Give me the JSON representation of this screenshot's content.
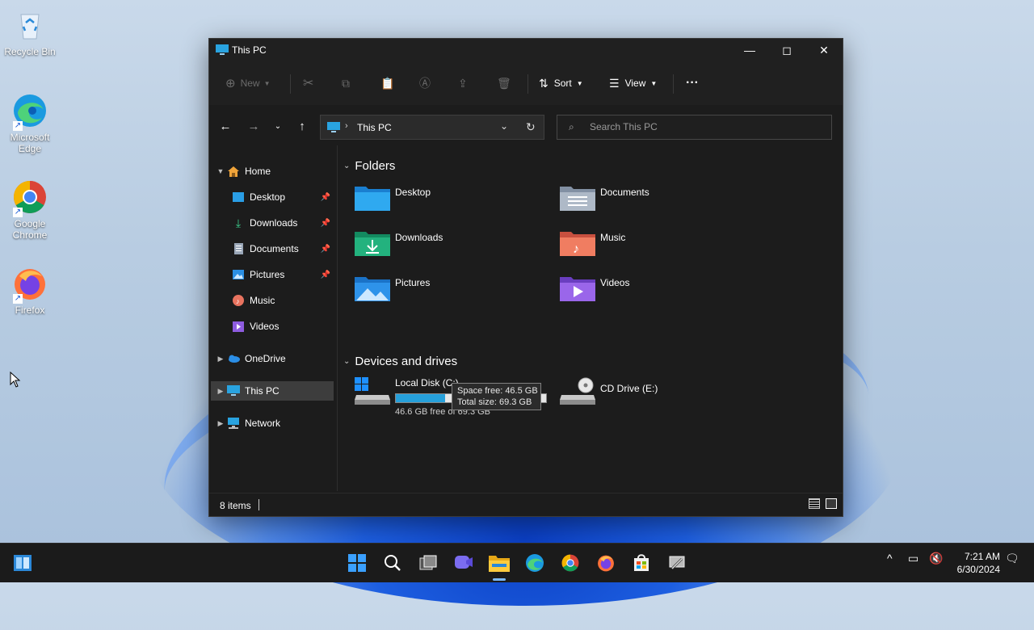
{
  "desktop": {
    "icons": [
      {
        "label": "Recycle Bin"
      },
      {
        "label": "Microsoft Edge"
      },
      {
        "label": "Google Chrome"
      },
      {
        "label": "Firefox"
      }
    ]
  },
  "window": {
    "title": "This PC",
    "toolbar": {
      "new_label": "New",
      "sort_label": "Sort",
      "view_label": "View",
      "more_label": "···"
    },
    "address": {
      "path": "This PC"
    },
    "search": {
      "placeholder": "Search This PC"
    },
    "sidebar": {
      "home": "Home",
      "items": [
        {
          "label": "Desktop"
        },
        {
          "label": "Downloads"
        },
        {
          "label": "Documents"
        },
        {
          "label": "Pictures"
        },
        {
          "label": "Music"
        },
        {
          "label": "Videos"
        }
      ],
      "onedrive": "OneDrive",
      "this_pc": "This PC",
      "network": "Network"
    },
    "folders": {
      "header": "Folders",
      "items": [
        {
          "name": "Desktop"
        },
        {
          "name": "Documents"
        },
        {
          "name": "Downloads"
        },
        {
          "name": "Music"
        },
        {
          "name": "Pictures"
        },
        {
          "name": "Videos"
        }
      ]
    },
    "drives": {
      "header": "Devices and drives",
      "local_disk": {
        "name": "Local Disk (C:)",
        "free_text": "46.6 GB free of 69.3 GB",
        "used_fraction": 0.33
      },
      "cd_drive": {
        "name": "CD Drive (E:)"
      }
    },
    "tooltip": {
      "line1": "Space free: 46.5 GB",
      "line2": "Total size: 69.3 GB"
    },
    "status": {
      "count": "8 items"
    }
  },
  "taskbar": {
    "time": "7:21 AM",
    "date": "6/30/2024"
  }
}
